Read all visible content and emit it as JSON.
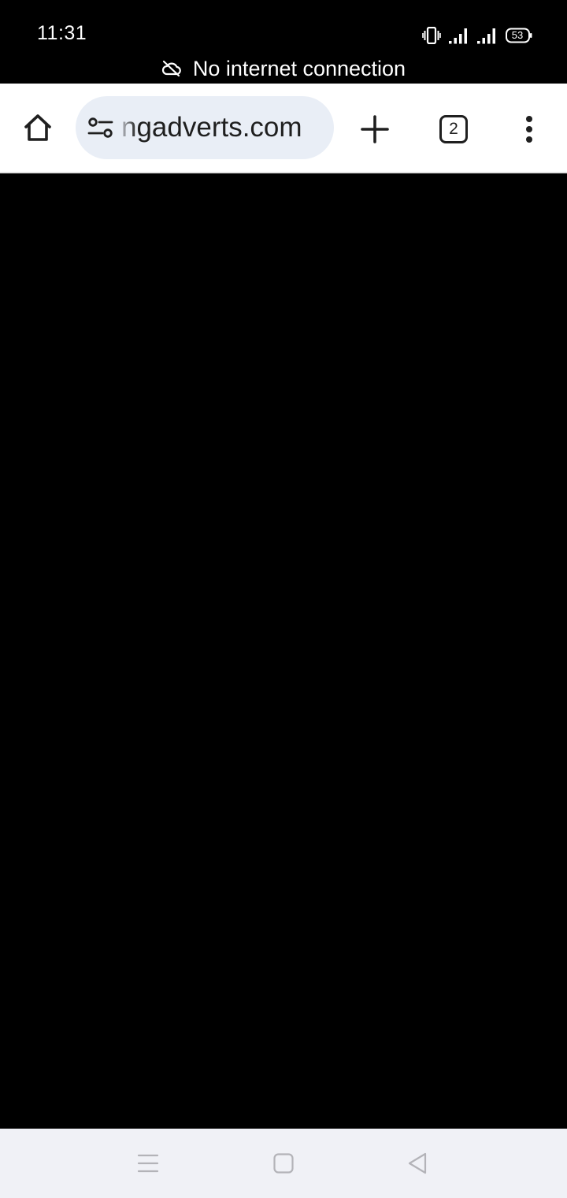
{
  "status_bar": {
    "time": "11:31",
    "battery_level": "53",
    "icons": [
      "vibrate-icon",
      "signal-1-icon",
      "signal-2-icon",
      "battery-icon"
    ],
    "offline_message": "No internet connection"
  },
  "toolbar": {
    "url": "ngadverts.com",
    "tab_count": "2",
    "icons": [
      "home-icon",
      "site-settings-icon",
      "new-tab-icon",
      "tab-switcher-icon",
      "more-options-icon"
    ]
  },
  "nav_bar": {
    "icons": [
      "recent-apps-icon",
      "home-nav-icon",
      "back-icon"
    ]
  },
  "colors": {
    "status_bg": "#000000",
    "toolbar_bg": "#ffffff",
    "omnibox_bg": "#e9eef6",
    "content_bg": "#000000",
    "nav_bg": "#f0f1f6",
    "icon": "#1f1f1f"
  }
}
